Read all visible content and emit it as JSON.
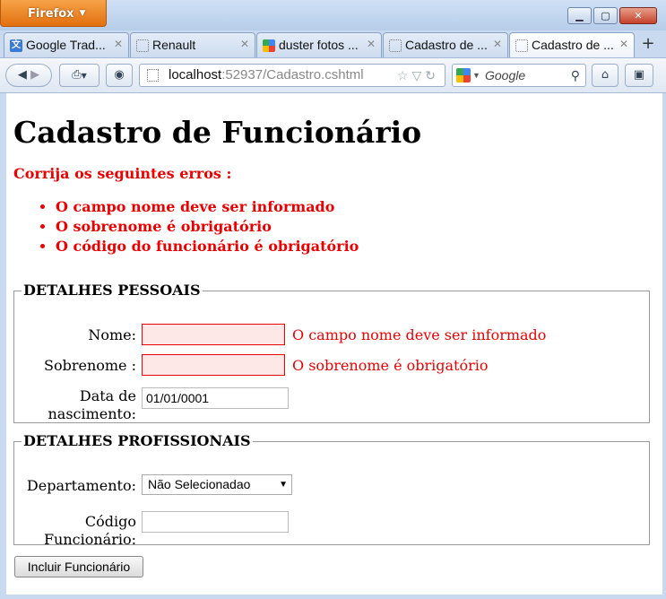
{
  "browser": {
    "menu_label": "Firefox",
    "tabs": [
      {
        "label": "Google Trad..."
      },
      {
        "label": "Renault"
      },
      {
        "label": "duster fotos ..."
      },
      {
        "label": "Cadastro de ..."
      },
      {
        "label": "Cadastro de ..."
      }
    ],
    "url_host": "localhost",
    "url_rest": ":52937/Cadastro.cshtml",
    "search_placeholder": "Google"
  },
  "page": {
    "title": "Cadastro de Funcionário",
    "error_title": "Corrija os seguintes erros :",
    "errors": [
      "O campo nome deve ser informado",
      "O sobrenome é obrigatório",
      "O código do funcionário é obrigatório"
    ]
  },
  "personal": {
    "legend": "DETALHES PESSOAIS",
    "nome_label": "Nome:",
    "nome_value": "",
    "nome_error": "O campo nome deve ser informado",
    "sobrenome_label": "Sobrenome :",
    "sobrenome_value": "",
    "sobrenome_error": "O sobrenome é obrigatório",
    "nascimento_label_1": "Data de",
    "nascimento_label_2": "nascimento:",
    "nascimento_value": "01/01/0001"
  },
  "professional": {
    "legend": "DETALHES PROFISSIONAIS",
    "departamento_label": "Departamento:",
    "departamento_value": "Não Selecionadao",
    "codigo_label_1": "Código",
    "codigo_label_2": "Funcionário:",
    "codigo_value": ""
  },
  "submit_label": "Incluir Funcionário"
}
